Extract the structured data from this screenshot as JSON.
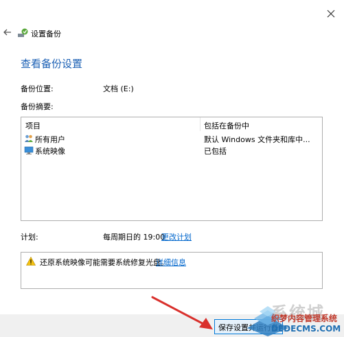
{
  "window": {
    "close_icon": "close-icon"
  },
  "header": {
    "back_icon": "back-arrow-icon",
    "app_icon": "backup-icon",
    "title": "设置备份"
  },
  "page": {
    "title": "查看备份设置"
  },
  "backup_location": {
    "label": "备份位置:",
    "value": "文档 (E:)"
  },
  "backup_summary": {
    "label": "备份摘要:"
  },
  "table": {
    "columns": [
      "项目",
      "包括在备份中"
    ],
    "rows": [
      {
        "icon": "users-icon",
        "name": "所有用户",
        "value": "默认 Windows 文件夹和库中..."
      },
      {
        "icon": "system-image-icon",
        "name": "系统映像",
        "value": "已包括"
      }
    ]
  },
  "schedule": {
    "label": "计划:",
    "value": "每周期日的 19:00",
    "link": "更改计划"
  },
  "warning": {
    "icon": "warning-icon",
    "text": "还原系统映像可能需要系统修复光盘。",
    "link": "详细信息"
  },
  "footer": {
    "save_button_label": "保存设置并运行备份"
  },
  "watermark": {
    "text1": "系统城",
    "text2": "织梦内容管理系统",
    "text3": "DEDECMS.COM"
  },
  "colors": {
    "title_blue": "#1a5fb4",
    "link_blue": "#0066cc",
    "arrow_red": "#d9302c",
    "button_border": "#0078d7"
  }
}
